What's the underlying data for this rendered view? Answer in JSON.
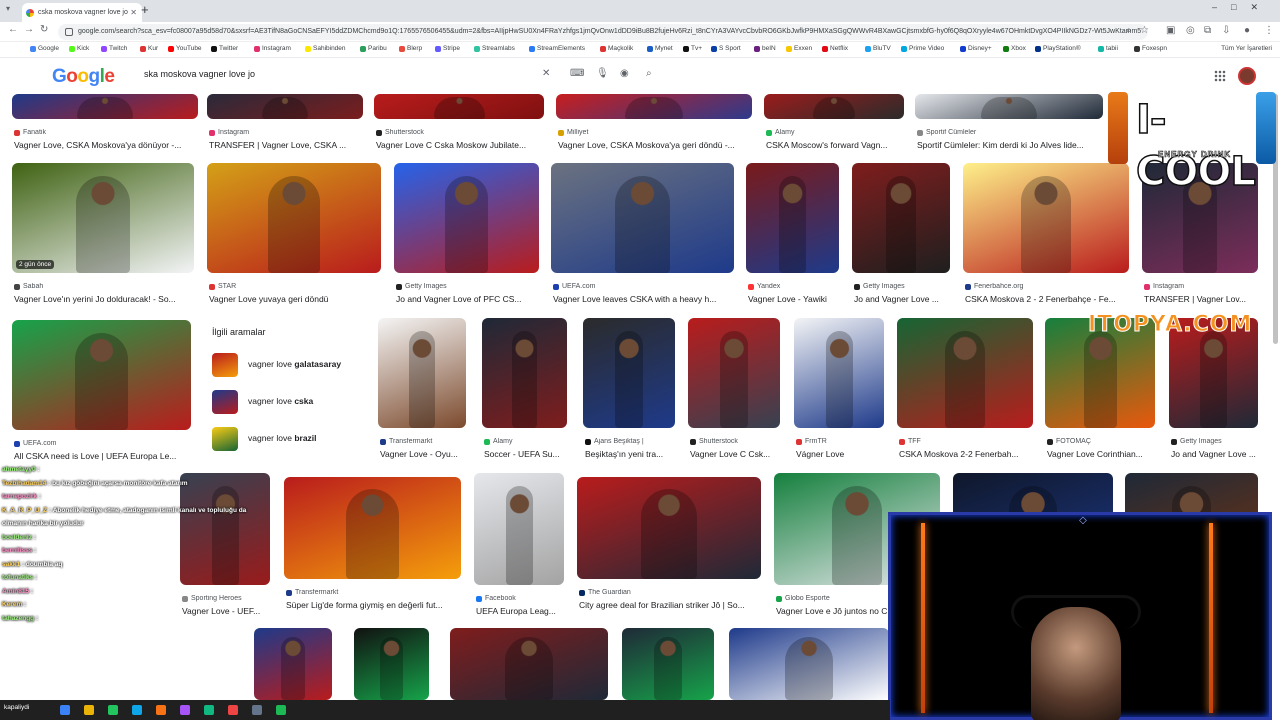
{
  "browser": {
    "tab_title": "cska moskova vagner love jo",
    "new_tab": "+",
    "url": "google.com/search?sca_esv=fc08007a95d58d70&sxsrf=AE3TifN8aGoCNSaEFYI5ddZDMChcmd9o1Q:1765576506455&udm=2&fbs=AIIjpHwSU0Xn4FRaYzhfgs1jmQvOnw1dDD9iBu8B2fujeHv6Rzi_t8nCYrA3VAYvcCbvbRO6GKbJwfkP9HMXaSGgQWWvR4BXawGCjtsmxbfG-hy0f6Q8qOXryyle4w67OHmktDvgXO4PIIkNGDz7-Wt5JwKtamm5",
    "bookmarks": [
      {
        "label": "Google",
        "color": "#4285f4"
      },
      {
        "label": "Kick",
        "color": "#53fc18"
      },
      {
        "label": "Twitch",
        "color": "#9146ff"
      },
      {
        "label": "Kur",
        "color": "#d33"
      },
      {
        "label": "YouTube",
        "color": "#ff0000"
      },
      {
        "label": "Twitter",
        "color": "#111"
      },
      {
        "label": "Instagram",
        "color": "#e1306c"
      },
      {
        "label": "Sahibinden",
        "color": "#ffe800"
      },
      {
        "label": "Paribu",
        "color": "#2b9e5a"
      },
      {
        "label": "Blerp",
        "color": "#e84a3b"
      },
      {
        "label": "Stripe",
        "color": "#635bff"
      },
      {
        "label": "Streamlabs",
        "color": "#31c3a2"
      },
      {
        "label": "StreamElements",
        "color": "#2a7bf6"
      },
      {
        "label": "Maçkolik",
        "color": "#d33"
      },
      {
        "label": "Mynet",
        "color": "#1a5ec4"
      },
      {
        "label": "Tv+",
        "color": "#111"
      },
      {
        "label": "S Sport",
        "color": "#0a3fa8"
      },
      {
        "label": "beIN",
        "color": "#6b1f7e"
      },
      {
        "label": "Exxen",
        "color": "#f7c700"
      },
      {
        "label": "Netflix",
        "color": "#e50914"
      },
      {
        "label": "BluTV",
        "color": "#1da1f2"
      },
      {
        "label": "Prime Video",
        "color": "#00a8e1"
      },
      {
        "label": "Disney+",
        "color": "#113ccf"
      },
      {
        "label": "Xbox",
        "color": "#107c10"
      },
      {
        "label": "PlayStation®",
        "color": "#003087"
      },
      {
        "label": "tabii",
        "color": "#14b8a6"
      },
      {
        "label": "Foxespn",
        "color": "#333"
      }
    ],
    "all_bookmarks": "Tüm Yer İşaretleri"
  },
  "google": {
    "logo": [
      "G",
      "o",
      "o",
      "g",
      "l",
      "e"
    ],
    "query": "ska moskova vagner love jo",
    "clear_symbol": "✕"
  },
  "results": [
    {
      "src": "Fanatik",
      "cap": "Vagner Love, CSKA Moskova'ya dönüyor -...",
      "fc": "#d33",
      "img": "#1e3a8a,#b91c1c"
    },
    {
      "src": "Instagram",
      "cap": "TRANSFER | Vagner Love, CSKA ...",
      "fc": "#e1306c",
      "img": "#2a2a3a,#7b1d1d"
    },
    {
      "src": "Shutterstock",
      "cap": "Vagner Love C Cska Moskow Jubilate...",
      "fc": "#222",
      "img": "#b91c1c,#7f1010"
    },
    {
      "src": "Milliyet",
      "cap": "Vagner Love, CSKA Moskova'ya geri döndü -...",
      "fc": "#d6a100",
      "img": "#c81e1e,#2d3a8c"
    },
    {
      "src": "Alamy",
      "cap": "CSKA Moscow's forward Vagn...",
      "fc": "#1db954",
      "img": "#9b1c1c,#2b2b2b"
    },
    {
      "src": "Sportif Cümleler",
      "cap": "Sportif Cümleler: Kim derdi ki Jo Alves lide...",
      "fc": "#888",
      "img": "#e5e7eb,#1f2937"
    },
    {
      "src": "Sabah",
      "cap": "Vagner Love'ın yerini Jo dolduracak! - So...",
      "fc": "#444",
      "img": "#3f6212,#f3f4f6",
      "badge": "2 gün önce"
    },
    {
      "src": "STAR",
      "cap": "Vagner Love yuvaya geri döndü",
      "fc": "#d33",
      "img": "#d4a017,#b91c1c"
    },
    {
      "src": "Getty Images",
      "cap": "Jo and Vagner Love of PFC CS...",
      "fc": "#222",
      "img": "#2563eb,#b91c1c"
    },
    {
      "src": "UEFA.com",
      "cap": "Vagner Love leaves CSKA with a heavy h...",
      "fc": "#1e40af",
      "img": "#6b7280,#1e3a8a"
    },
    {
      "src": "Yandex",
      "cap": "Vagner Love - Yawiki",
      "fc": "#ff3333",
      "img": "#7a1a1a,#1e3a8a"
    },
    {
      "src": "Getty Images",
      "cap": "Jo and Vagner Love ...",
      "fc": "#222",
      "img": "#7f1d1d,#1f1f1f"
    },
    {
      "src": "Fenerbahce.org",
      "cap": "CSKA Moskova 2 - 2 Fenerbahçe - Fe...",
      "fc": "#1e3a8a",
      "img": "#fef08a,#b91c1c"
    },
    {
      "src": "Instagram",
      "cap": "TRANSFER | Vagner Lov...",
      "fc": "#e1306c",
      "img": "#1f2937,#7c2d5a"
    },
    {
      "src": "UEFA.com",
      "cap": "All CSKA need is Love | UEFA Europa Le...",
      "fc": "#1e40af",
      "img": "#16a34a,#b91c1c"
    },
    {
      "src": "Transfermarkt",
      "cap": "Vagner Love - Oyu...",
      "fc": "#1e3a8a",
      "img": "#f5f5f5,#7c4a2d"
    },
    {
      "src": "Alamy",
      "cap": "Soccer - UEFA Su...",
      "fc": "#1db954",
      "img": "#1f2937,#7f1d1d"
    },
    {
      "src": "Ajans Beşiktaş |",
      "cap": "Beşiktaş'ın yeni tra...",
      "fc": "#111",
      "img": "#2b2b2b,#1e3a8a"
    },
    {
      "src": "Shutterstock",
      "cap": "Vagner Love C Csk...",
      "fc": "#222",
      "img": "#b91c1c,#374151"
    },
    {
      "src": "FrmTR",
      "cap": "Vágner Love",
      "fc": "#d33",
      "img": "#f3f4f6,#1e3a8a"
    },
    {
      "src": "TFF",
      "cap": "CSKA Moskova 2-2 Fenerbah...",
      "fc": "#d33",
      "img": "#166534,#b91c1c"
    },
    {
      "src": "FOTOMAÇ",
      "cap": "Vagner Love Corinthian...",
      "fc": "#222",
      "img": "#15803d,#ea580c"
    },
    {
      "src": "Getty Images",
      "cap": "Jo and Vagner Love ...",
      "fc": "#222",
      "img": "#b91c1c,#1f2937"
    },
    {
      "src": "Sporting Heroes",
      "cap": "Vagner Love - UEF...",
      "fc": "#888",
      "img": "#374151,#991b1b"
    },
    {
      "src": "Transfermarkt",
      "cap": "Süper Lig'de forma giymiş en değerli fut...",
      "fc": "#1e3a8a",
      "img": "#b91c1c,#f59e0b"
    },
    {
      "src": "Facebook",
      "cap": "UEFA Europa Leag...",
      "fc": "#1877f2",
      "img": "#e5e7eb,#a3a3a3"
    },
    {
      "src": "The Guardian",
      "cap": "City agree deal for Brazilian striker Jô | So...",
      "fc": "#052962",
      "img": "#b91c1c,#1f2937"
    },
    {
      "src": "Globo Esporte",
      "cap": "Vagner Love e Jô juntos no C...",
      "fc": "#16a34a",
      "img": "#15803d,#e5e7eb"
    },
    {
      "src": "",
      "cap": "",
      "fc": "#888",
      "img": "#0f172a,#1e3a8a"
    },
    {
      "src": "",
      "cap": "",
      "fc": "#888",
      "img": "#1f2937,#78350f"
    },
    {
      "src": "",
      "cap": "",
      "fc": "#888",
      "img": "#1e3a8a,#b91c1c"
    },
    {
      "src": "",
      "cap": "",
      "fc": "#888",
      "img": "#111,#16a34a"
    },
    {
      "src": "",
      "cap": "",
      "fc": "#888",
      "img": "#7f1d1d,#1f2937"
    },
    {
      "src": "",
      "cap": "",
      "fc": "#888",
      "img": "#1f2937,#16a34a"
    },
    {
      "src": "",
      "cap": "",
      "fc": "#888",
      "img": "#1e3a8a,#ffffff"
    }
  ],
  "related": {
    "title": "İlgili aramalar",
    "items": [
      {
        "prefix": "vagner love ",
        "bold": "galatasaray",
        "img": "#b91c1c,#f59e0b"
      },
      {
        "prefix": "vagner love ",
        "bold": "cska",
        "img": "#1e3a8a,#b91c1c"
      },
      {
        "prefix": "vagner love ",
        "bold": "brazil",
        "img": "#facc15,#166534"
      }
    ]
  },
  "overlay": {
    "ad_title": "I-COOL",
    "ad_subtitle": "ENERGY DRINK",
    "watermark": "ITOPYA.COM",
    "chat": [
      {
        "user": "ahmetayy0",
        "text": ":",
        "uc": "u"
      },
      {
        "user": "Tezbihadam14",
        "text": ": bu kız göbeğini açarsa monitöre kafa atarım",
        "uc": "u2"
      },
      {
        "user": "tarnepozirk",
        "text": ":",
        "uc": "u3"
      },
      {
        "user": "K_A_R_P_U_Z",
        "text": ": Abonelik hediye etme, atadoganın isimli kanalı ve topluluğu da",
        "uc": "u2"
      },
      {
        "user": "",
        "text": "olmanın harika bir yoludur",
        "uc": "u"
      },
      {
        "user": "boeldeniz",
        "text": ":",
        "uc": "u"
      },
      {
        "user": "bernilisss",
        "text": ":",
        "uc": "u3"
      },
      {
        "user": "sakk1",
        "text": ": doumbia aq",
        "uc": "u2"
      },
      {
        "user": "tofunatiks",
        "text": ":",
        "uc": "u"
      },
      {
        "user": "Amin815",
        "text": ":",
        "uc": "u3"
      },
      {
        "user": "Kerem",
        "text": ":",
        "uc": "u2"
      },
      {
        "user": "tahazengg",
        "text": ":",
        "uc": "u"
      }
    ],
    "taskbar_label": "kapaliydi"
  }
}
